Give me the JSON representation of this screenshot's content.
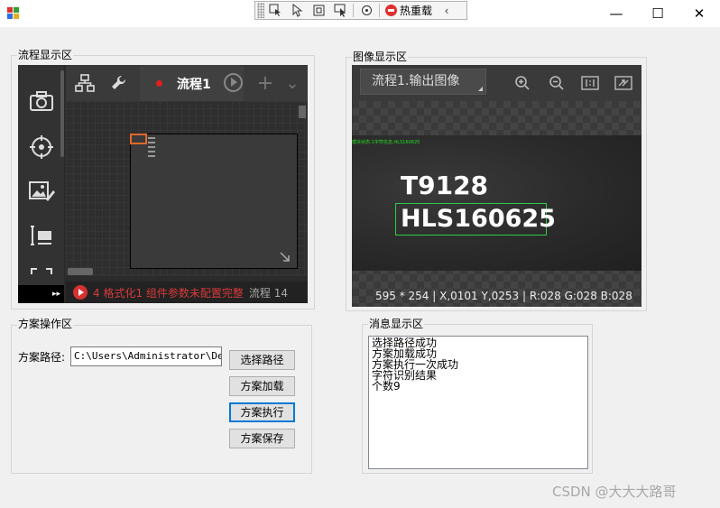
{
  "debug_toolbar": {
    "hot_reload_label": "热重载",
    "collapse_glyph": "‹"
  },
  "window_controls": {
    "minimize_glyph": "—",
    "maximize_glyph": "☐",
    "close_glyph": "✕"
  },
  "flow_group": {
    "title": "流程显示区",
    "tab_label": "流程1",
    "add_glyph": "+",
    "dropdown_glyph": "⌄",
    "bottom_left_glyph": "▸▸",
    "status_message": "4 格式化1 组件参数未配置完整",
    "status_extra": "流程  14",
    "sidebar_icons": [
      "camera-icon",
      "target-icon",
      "image-edit-icon",
      "io-icon",
      "frame-icon"
    ]
  },
  "image_group": {
    "title": "图像显示区",
    "output_selector": "流程1.输出图像",
    "overlay_status": "模块状态:1字符信息:HLS160625",
    "recognized_text_1": "T9128",
    "recognized_text_2": "HLS160625",
    "status_bar": "595 * 254    | X,0101  Y,0253  | R:028  G:028  B:028"
  },
  "scheme_group": {
    "title": "方案操作区",
    "path_label": "方案路径:",
    "path_value": "C:\\Users\\Administrator\\Desk",
    "buttons": {
      "select_path": "选择路径",
      "load": "方案加载",
      "execute": "方案执行",
      "save": "方案保存"
    }
  },
  "message_group": {
    "title": "消息显示区",
    "messages": [
      "选择路径成功",
      "方案加载成功",
      "方案执行一次成功",
      "字符识别结果",
      "个数9"
    ]
  },
  "watermark": "CSDN @大大大路哥",
  "colors": {
    "accent_focus": "#0078d7",
    "error_red": "#d83a3a",
    "ocr_box_green": "#2ecc40",
    "node_orange": "#e0682a"
  }
}
